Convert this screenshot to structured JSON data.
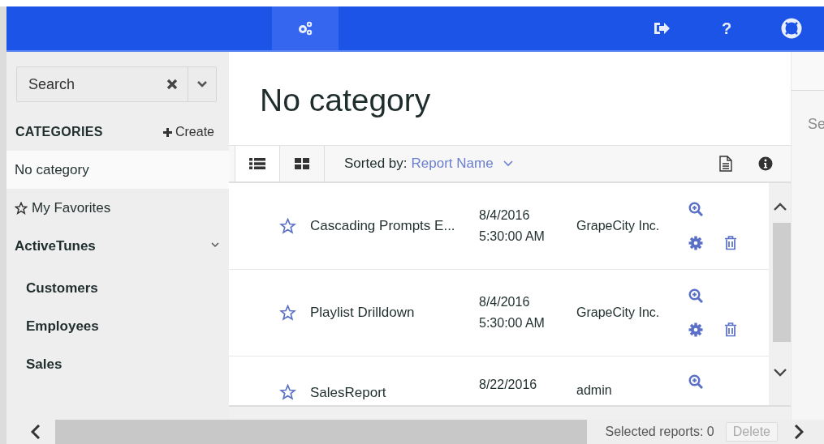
{
  "nav": {
    "items": [
      {
        "kind": "gears",
        "selected": true
      },
      {
        "kind": "exit",
        "selected": false
      },
      {
        "kind": "text",
        "text": "?",
        "selected": false
      },
      {
        "kind": "lifebuoy",
        "selected": false
      }
    ]
  },
  "sidebar": {
    "search": {
      "placeholder": "Search"
    },
    "header": "CATEGORIES",
    "create": "Create",
    "items": [
      {
        "label": "No category",
        "kind": "plain",
        "selected": true
      },
      {
        "label": "My Favorites",
        "kind": "favorites",
        "selected": false
      },
      {
        "label": "ActiveTunes",
        "kind": "group",
        "selected": false,
        "expanded": true,
        "children": [
          {
            "label": "Customers",
            "selected": false
          },
          {
            "label": "Employees",
            "selected": false
          },
          {
            "label": "Sales",
            "selected": false
          }
        ]
      }
    ]
  },
  "main": {
    "title": "No category",
    "views": [
      {
        "kind": "list",
        "selected": true
      },
      {
        "kind": "grid",
        "selected": false
      }
    ],
    "sort_label": "Sorted by:",
    "sort_value": "Report Name",
    "reports": [
      {
        "favorite": false,
        "name": "Cascading Prompts E...",
        "date": "8/4/2016",
        "time": "5:30:00 AM",
        "author": "GrapeCity Inc.",
        "editable": true
      },
      {
        "favorite": false,
        "name": "Playlist Drilldown",
        "date": "8/4/2016",
        "time": "5:30:00 AM",
        "author": "GrapeCity Inc.",
        "editable": true
      },
      {
        "favorite": false,
        "name": "SalesReport",
        "date": "8/22/2016",
        "author": "admin",
        "editable": false
      }
    ],
    "selected_count": "Selected reports: 0",
    "delete": {
      "label": "Delete",
      "disabled": true
    }
  },
  "side_panel": {
    "text": "Se"
  }
}
